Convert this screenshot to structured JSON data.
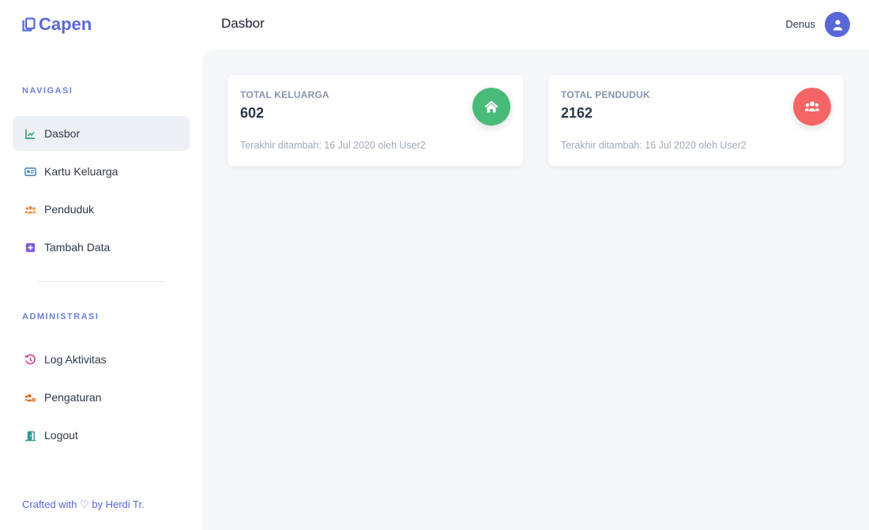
{
  "brand": {
    "name": "Capen",
    "color": "#5a67d8"
  },
  "header": {
    "title": "Dasbor",
    "user_name": "Denus"
  },
  "sidebar": {
    "sections": [
      {
        "heading": "NAVIGASI",
        "items": [
          {
            "label": "Dasbor",
            "icon": "chart-line-icon",
            "icon_color": "#3aa37a",
            "active": true
          },
          {
            "label": "Kartu Keluarga",
            "icon": "id-card-icon",
            "icon_color": "#3b82c4"
          },
          {
            "label": "Penduduk",
            "icon": "users-icon",
            "icon_color": "#ed8936"
          },
          {
            "label": "Tambah Data",
            "icon": "plus-square-icon",
            "icon_color": "#805ad5"
          }
        ]
      },
      {
        "heading": "ADMINISTRASI",
        "items": [
          {
            "label": "Log Aktivitas",
            "icon": "history-icon",
            "icon_color": "#d53f8c"
          },
          {
            "label": "Pengaturan",
            "icon": "users-cog-icon",
            "icon_color": "#dd6b20"
          },
          {
            "label": "Logout",
            "icon": "door-open-icon",
            "icon_color": "#319795"
          }
        ]
      }
    ],
    "credit": "Crafted with ♡ by Herdi Tr."
  },
  "cards": [
    {
      "label": "TOTAL KELUARGA",
      "value": "602",
      "meta": "Terakhir ditambah: 16 Jul 2020 oleh User2",
      "icon": "home-icon",
      "badge_color": "#48bb78"
    },
    {
      "label": "TOTAL PENDUDUK",
      "value": "2162",
      "meta": "Terakhir ditambah: 16 Jul 2020 oleh User2",
      "icon": "users-icon",
      "badge_color": "#f56565"
    }
  ]
}
